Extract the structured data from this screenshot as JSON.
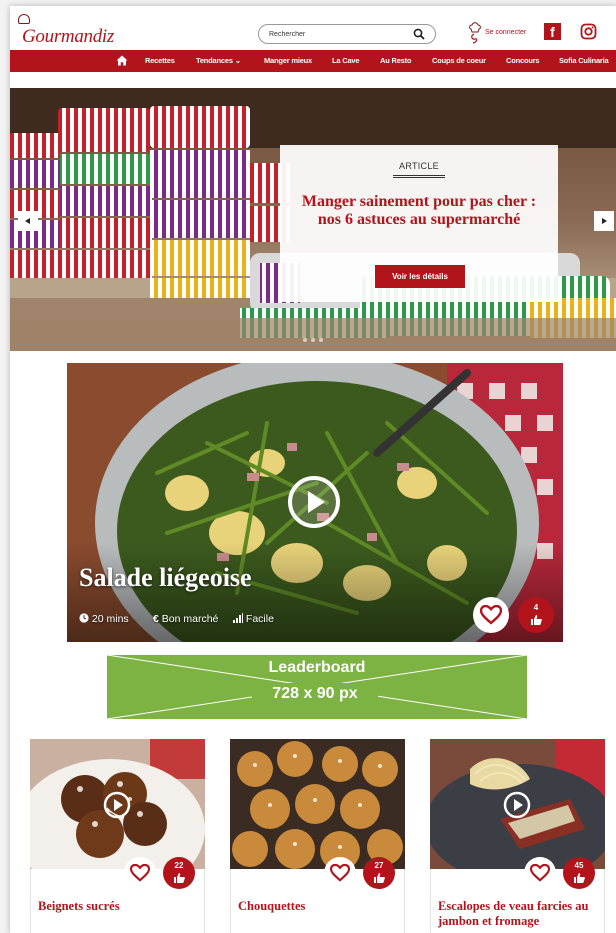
{
  "header": {
    "logo_text": "Gourmandiz",
    "search_placeholder": "Rechercher",
    "login_label": "Se connecter",
    "facebook_glyph": "f"
  },
  "nav": {
    "items": [
      "Recettes",
      "Tendances",
      "Manger mieux",
      "La Cave",
      "Au Resto",
      "Coups de coeur",
      "Concours",
      "Sofia Culinaria"
    ],
    "dropdown_glyph": "⌄"
  },
  "hero": {
    "tag": "ARTICLE",
    "title": "Manger sainement pour pas cher : nos 6 astuces au supermarché",
    "button_label": "Voir les détails"
  },
  "featured": {
    "title": "Salade liégeoise",
    "time": "20 mins",
    "price": "Bon marché",
    "difficulty": "Facile",
    "likes": "4"
  },
  "ad": {
    "line1": "Leaderboard",
    "line2": "728 x 90 px"
  },
  "recipes": [
    {
      "name": "Beignets sucrés",
      "likes": "22"
    },
    {
      "name": "Chouquettes",
      "likes": "27"
    },
    {
      "name": "Escalopes de veau farcies au jambon et fromage",
      "likes": "45"
    }
  ],
  "colors": {
    "brand": "#b3141b",
    "ad_green": "#7cb342"
  },
  "icons": [
    "chef-hat-icon",
    "search-icon",
    "facebook-icon",
    "instagram-icon",
    "home-icon",
    "play-icon",
    "heart-icon",
    "thumb-icon",
    "clock-icon",
    "euro-icon",
    "signal-icon"
  ]
}
